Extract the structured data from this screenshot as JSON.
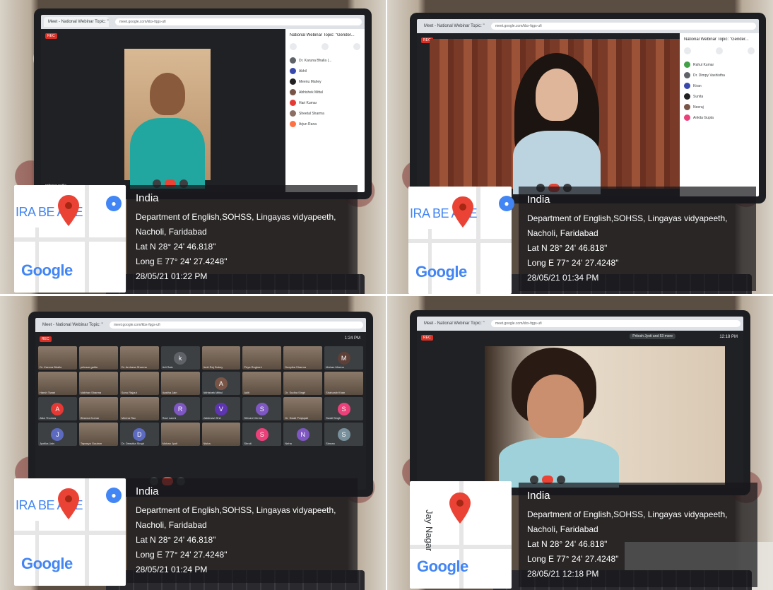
{
  "meet": {
    "tab_label": "Meet - National Webinar Topic: \"Gender...",
    "address": "meet.google.com/kbx-fqgs-ufi",
    "rec_label": "REC",
    "panel_title": "National Webinar Topic: \"Gender...",
    "self_name_1": "pritosar gatila",
    "participants_1": [
      "Dr. Karuna Bhalla (...",
      "Akhil",
      "Meenu Mahey",
      "Abhishek Mittal",
      "Hari Kumar",
      "Sheetal Sharma",
      "Arjun Rana"
    ],
    "participants_2": [
      "Rahul Kumar",
      "Dr. Dimpy Vashistha",
      "Kiran",
      "Sunita",
      "Neeraj",
      "Ankita Gupta"
    ],
    "gallery_tiles": [
      {
        "name": "Dr. Karuna Bhalla",
        "initial": "",
        "color": "",
        "cam": true
      },
      {
        "name": "pritosar gatila",
        "initial": "",
        "color": "",
        "cam": true
      },
      {
        "name": "Dr. Archana Sharma",
        "initial": "",
        "color": "",
        "cam": true
      },
      {
        "name": "Arti Sain",
        "initial": "k",
        "color": "#5f6368",
        "cam": false
      },
      {
        "name": "Amit Raj Dubey",
        "initial": "",
        "color": "",
        "cam": true
      },
      {
        "name": "Priya Rughani",
        "initial": "",
        "color": "",
        "cam": true
      },
      {
        "name": "Deepika Sharma",
        "initial": "",
        "color": "",
        "cam": true
      },
      {
        "name": "Mohan Meena",
        "initial": "M",
        "color": "#5d4037",
        "cam": false
      },
      {
        "name": "Harsh Tiwari",
        "initial": "",
        "color": "",
        "cam": true
      },
      {
        "name": "Vaibhav Sharma",
        "initial": "",
        "color": "",
        "cam": true
      },
      {
        "name": "Sonu Rajput",
        "initial": "",
        "color": "",
        "cam": true
      },
      {
        "name": "Aastha Jain",
        "initial": "",
        "color": "",
        "cam": true
      },
      {
        "name": "Abhishek Mittal",
        "initial": "A",
        "color": "#795548",
        "cam": false
      },
      {
        "name": "Aditi",
        "initial": "",
        "color": "",
        "cam": true
      },
      {
        "name": "Dr. Sudha Singh",
        "initial": "",
        "color": "",
        "cam": true
      },
      {
        "name": "Shahzaib Khan",
        "initial": "",
        "color": "",
        "cam": true
      },
      {
        "name": "Alka Thomas",
        "initial": "A",
        "color": "#e53935",
        "cam": false
      },
      {
        "name": "Bhavna Kumar",
        "initial": "",
        "color": "",
        "cam": true
      },
      {
        "name": "Meena Rao",
        "initial": "",
        "color": "",
        "cam": true
      },
      {
        "name": "Ravi Laxmi",
        "initial": "R",
        "color": "#7e57c2",
        "cam": false
      },
      {
        "name": "Vaishnavi Shri",
        "initial": "V",
        "color": "#5e35b1",
        "cam": false
      },
      {
        "name": "Shivani Verma",
        "initial": "S",
        "color": "#7e57c2",
        "cam": false
      },
      {
        "name": "Dr. Swati Prajapati",
        "initial": "",
        "color": "",
        "cam": true
      },
      {
        "name": "Swati Singh",
        "initial": "S",
        "color": "#ec407a",
        "cam": false
      },
      {
        "name": "Jyotika Jain",
        "initial": "J",
        "color": "#5c6bc0",
        "cam": false
      },
      {
        "name": "Tapasya Gautam",
        "initial": "",
        "color": "",
        "cam": true
      },
      {
        "name": "Dr. Deepika Singh",
        "initial": "D",
        "color": "#5c6bc0",
        "cam": false
      },
      {
        "name": "Mohan Jyoti",
        "initial": "",
        "color": "",
        "cam": true
      },
      {
        "name": "Nisha",
        "initial": "",
        "color": "",
        "cam": true
      },
      {
        "name": "Shruti",
        "initial": "S",
        "color": "#ec407a",
        "cam": false
      },
      {
        "name": "Neha",
        "initial": "N",
        "color": "#7e57c2",
        "cam": false
      },
      {
        "name": "Simran",
        "initial": "S",
        "color": "#78909c",
        "cam": false
      }
    ],
    "time_3": "1:24 PM",
    "time_4": "12:18 PM",
    "meet_code_4": "Pritosh Jyoti and 53 more"
  },
  "photos": [
    {
      "country": "India",
      "address_line1": "Department of English,SOHSS, Lingayas vidyapeeth,",
      "address_line2": "Nacholi, Faridabad",
      "lat": "Lat N 28° 24' 46.818\"",
      "long": "Long E 77° 24' 27.4248\"",
      "datetime": "28/05/21 01:22 PM",
      "map_street": "IRA BE  AGE",
      "map_logo": "Google"
    },
    {
      "country": "India",
      "address_line1": "Department of English,SOHSS, Lingayas vidyapeeth,",
      "address_line2": "Nacholi, Faridabad",
      "lat": "Lat N 28° 24' 46.818\"",
      "long": "Long E 77° 24' 27.4248\"",
      "datetime": "28/05/21 01:34 PM",
      "map_street": "IRA BE  AGE",
      "map_logo": "Google"
    },
    {
      "country": "India",
      "address_line1": "Department of English,SOHSS, Lingayas vidyapeeth,",
      "address_line2": "Nacholi, Faridabad",
      "lat": "Lat N 28° 24' 46.818\"",
      "long": "Long E 77° 24' 27.4248\"",
      "datetime": "28/05/21 01:24 PM",
      "map_street": "IRA BE  AGE",
      "map_logo": "Google"
    },
    {
      "country": "India",
      "address_line1": "Department of English,SOHSS, Lingayas vidyapeeth,",
      "address_line2": "Nacholi, Faridabad",
      "lat": "Lat N 28° 24' 46.818\"",
      "long": "Long E 77° 24' 27.4248\"",
      "datetime": "28/05/21 12:18 PM",
      "map_street": "Jay Nagar",
      "map_logo": "Google"
    }
  ],
  "icons": {
    "pin": "map-pin-icon",
    "badge": "maps-badge-icon",
    "mic": "mic-icon",
    "camera": "camera-icon",
    "end_call": "end-call-icon"
  },
  "colors": {
    "pin_red": "#ea4335",
    "google_blue": "#4285f4",
    "overlay": "#18181c",
    "meet_dark": "#202124"
  }
}
